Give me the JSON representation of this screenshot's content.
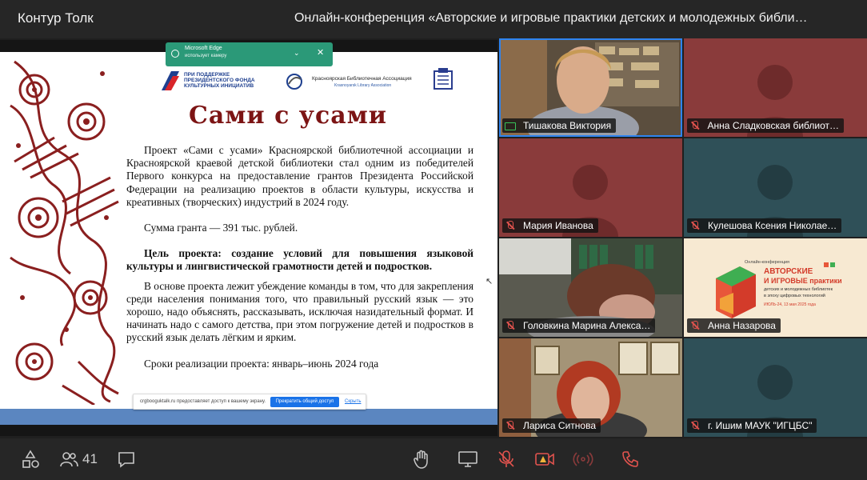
{
  "app": {
    "name": "Контур Толк"
  },
  "conference": {
    "title": "Онлайн-конференция «Авторские и игровые практики детских и молодежных библи…"
  },
  "edge_notice": {
    "line1": "Microsoft Edge",
    "line2": "использует камеру"
  },
  "slide": {
    "logo1": "ПРИ ПОДДЕРЖКЕ ПРЕЗИДЕНТСКОГО ФОНДА КУЛЬТУРНЫХ ИНИЦИАТИВ",
    "logo2": "Красноярская Библиотечная Ассоциация",
    "logo2_sub": "Krasnoyarsk Library Association",
    "heading": "Сами с усами",
    "para1": "Проект «Сами с усами» Красноярской библиотечной ассоциации и Красноярской краевой детской библиотеки стал одним из победителей Первого конкурса на предоставление грантов Президента Российской Федерации на реализацию проектов в области культуры, искусства и креативных (творческих) индустрий в 2024 году.",
    "para2": "Сумма гранта — 391 тыс. рублей.",
    "para3": "Цель проекта: создание условий для повышения языковой культуры и лингвистической грамотности детей и подростков.",
    "para4": "В основе проекта лежит убеждение команды в том, что для закрепления среди населения понимания того, что правильный русский язык — это хорошо, надо объяснять, рассказывать, исключая назидательный формат. И начинать надо с самого детства, при этом погружение детей и подростков в русский язык делать лёгким и ярким.",
    "para5": "Сроки реализации проекта: январь–июнь 2024 года"
  },
  "share_bar": {
    "text": "crgbooguktalk.ru предоставляет доступ к вашему экрану.",
    "stop_label": "Прекратить общий доступ",
    "hide_label": "Скрыть"
  },
  "participants": [
    {
      "name": "Тишакова Виктория",
      "mic": "on",
      "kind": "video",
      "bg": "#6b5a44"
    },
    {
      "name": "Анна Сладковская библиот…",
      "mic": "off",
      "kind": "avatar",
      "bg": "#8a3b3b"
    },
    {
      "name": "Мария Иванова",
      "mic": "off",
      "kind": "avatar",
      "bg": "#8a3b3b"
    },
    {
      "name": "Кулешова Ксения Николае…",
      "mic": "off",
      "kind": "avatar",
      "bg": "#2f5058"
    },
    {
      "name": "Головкина Марина Алекса…",
      "mic": "off",
      "kind": "video",
      "bg": "#4a4a42"
    },
    {
      "name": "Анна Назарова",
      "mic": "off",
      "kind": "poster",
      "bg": "#f5e6cc"
    },
    {
      "name": "Лариса Ситнова",
      "mic": "off",
      "kind": "video",
      "bg": "#8a7a62"
    },
    {
      "name": "г. Ишим МАУК \"ИГЦБС\"",
      "mic": "off",
      "kind": "avatar",
      "bg": "#2f5058"
    }
  ],
  "poster": {
    "line1": "Онлайн-конференция",
    "line2": "АВТОРСКИЕ",
    "line3": "И ИГРОВЫЕ практики",
    "line4": "детских и молодежных библиотек",
    "line5": "в эпоху цифровых технологий",
    "line6": "ИЮЛЬ-24, 13 мая 2025 года"
  },
  "toolbar": {
    "participants_count": "41"
  },
  "colors": {
    "brand_red": "#7c1414",
    "active_outline": "#2e84f0",
    "mic_off": "#e2534e",
    "mic_on": "#38c35a",
    "end_call": "#e2534e"
  }
}
